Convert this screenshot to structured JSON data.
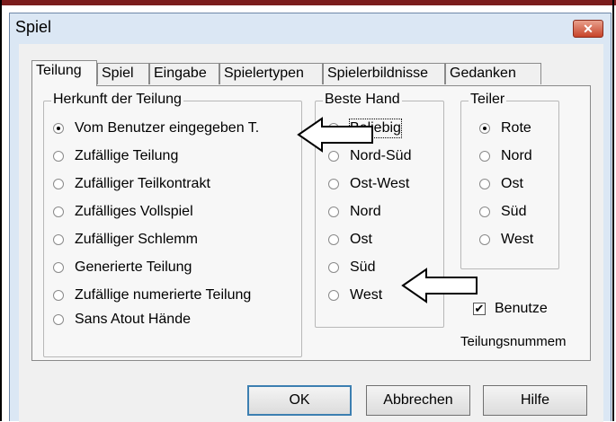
{
  "window": {
    "title": "Spiel",
    "close_icon": "close-icon"
  },
  "tabs": [
    {
      "label": "Teilung",
      "active": true
    },
    {
      "label": "Spiel",
      "active": false
    },
    {
      "label": "Eingabe",
      "active": false
    },
    {
      "label": "Spielertypen",
      "active": false
    },
    {
      "label": "Spielerbildnisse",
      "active": false
    },
    {
      "label": "Gedanken",
      "active": false
    }
  ],
  "herkunft": {
    "legend": "Herkunft der Teilung",
    "options": [
      {
        "label": "Vom Benutzer eingegeben T.",
        "selected": true
      },
      {
        "label": "Zufällige Teilung",
        "selected": false
      },
      {
        "label": "Zufälliger Teilkontrakt",
        "selected": false
      },
      {
        "label": "Zufälliges Vollspiel",
        "selected": false
      },
      {
        "label": "Zufälliger Schlemm",
        "selected": false
      },
      {
        "label": "Generierte Teilung",
        "selected": false
      },
      {
        "label": "Zufällige numerierte Teilung",
        "selected": false
      },
      {
        "label": "Sans Atout Hände",
        "selected": false
      }
    ]
  },
  "beste_hand": {
    "legend": "Beste Hand",
    "options": [
      {
        "label": "Beliebig",
        "selected": true
      },
      {
        "label": "Nord-Süd",
        "selected": false
      },
      {
        "label": "Ost-West",
        "selected": false
      },
      {
        "label": "Nord",
        "selected": false
      },
      {
        "label": "Ost",
        "selected": false
      },
      {
        "label": "Süd",
        "selected": false
      },
      {
        "label": "West",
        "selected": false
      }
    ]
  },
  "teiler": {
    "legend": "Teiler",
    "options": [
      {
        "label": "Rote",
        "selected": true
      },
      {
        "label": "Nord",
        "selected": false
      },
      {
        "label": "Ost",
        "selected": false
      },
      {
        "label": "Süd",
        "selected": false
      },
      {
        "label": "West",
        "selected": false
      }
    ]
  },
  "benutze": {
    "label": "Benutze",
    "checked": true,
    "check_mark": "✔"
  },
  "teilungsnummern_label": "Teilungsnummem",
  "buttons": {
    "ok": "OK",
    "cancel": "Abbrechen",
    "help": "Hilfe"
  },
  "colors": {
    "title_bg": "#dbe7f4",
    "accent_strip": "#7b1d1d",
    "close_button": "#c7442a"
  }
}
